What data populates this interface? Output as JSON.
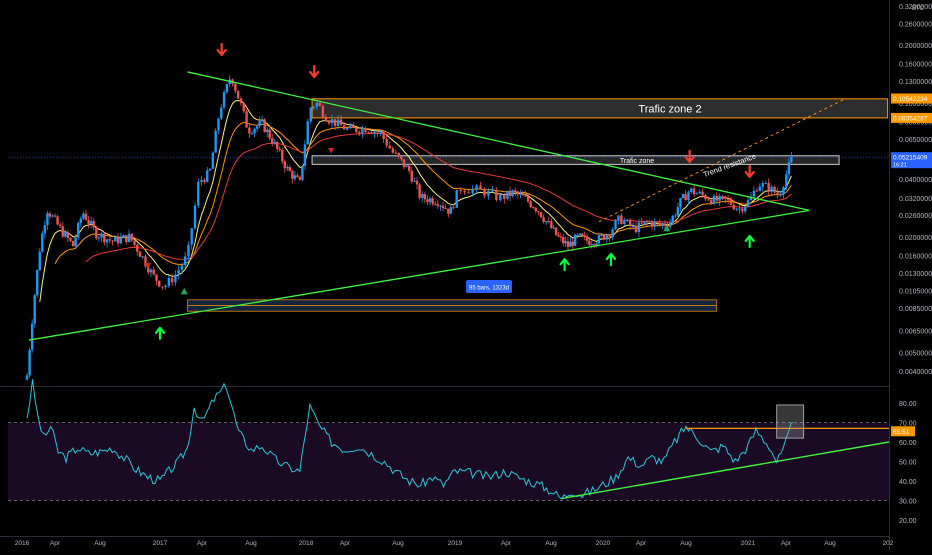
{
  "colors": {
    "background": "#000000",
    "up": "#2196f3",
    "down": "#ef5350",
    "wick_up": "#2196f3",
    "wick_down": "#ef5350",
    "ema_fast": "#fff176",
    "ema_mid": "#ff9800",
    "ema_slow": "#e53935",
    "trendline": "#3ef23e",
    "zone_border": "#ff9800",
    "zone_fill": "#3c3c3c",
    "rsi_line": "#26c6da",
    "rsi_band": "#1a0a23",
    "axis_text": "#b2b5be",
    "price_tag_blue": "#2962ff",
    "price_tag_orange": "#ff9800"
  },
  "chart_data": [
    {
      "type": "candlestick",
      "title": "",
      "quote_unit": "BTC",
      "y_scale": "log",
      "ylim": [
        0.0037,
        0.34
      ],
      "x_range": [
        "2016-01-01",
        "2021-12-31"
      ],
      "x_tick_labels": [
        "2016",
        "Apr",
        "Aug",
        "2017",
        "Apr",
        "Aug",
        "2018",
        "Apr",
        "Aug",
        "2019",
        "Apr",
        "Aug",
        "2020",
        "Apr",
        "Aug",
        "2021",
        "Apr",
        "Aug",
        "202"
      ],
      "x_tick_dates": [
        "2016-01-01",
        "2016-04-01",
        "2016-08-01",
        "2017-01-01",
        "2017-04-01",
        "2017-08-01",
        "2018-01-01",
        "2018-04-01",
        "2018-08-01",
        "2019-01-01",
        "2019-04-01",
        "2019-08-01",
        "2020-01-01",
        "2020-04-01",
        "2020-08-01",
        "2021-01-01",
        "2021-04-01",
        "2021-08-01",
        "2022-01-01"
      ],
      "y_tick_labels": [
        "0.3200000",
        "0.2600000",
        "0.2000000",
        "0.1600000",
        "0.1300000",
        "0.1000000",
        "0.0800000",
        "0.0650000",
        "0.0500000",
        "0.0400000",
        "0.0320000",
        "0.0260000",
        "0.0200000",
        "0.0160000",
        "0.0130000",
        "0.0105000",
        "0.0085000",
        "0.0065000",
        "0.0050000",
        "0.0040000"
      ],
      "y_tick_values": [
        0.32,
        0.26,
        0.2,
        0.16,
        0.13,
        0.1,
        0.08,
        0.065,
        0.05,
        0.04,
        0.032,
        0.026,
        0.02,
        0.016,
        0.013,
        0.0105,
        0.0085,
        0.0065,
        0.005,
        0.004
      ],
      "close_anchors": [
        [
          "2016-01-15",
          0.0038
        ],
        [
          "2016-02-01",
          0.0086
        ],
        [
          "2016-02-20",
          0.018
        ],
        [
          "2016-03-10",
          0.028
        ],
        [
          "2016-04-15",
          0.022
        ],
        [
          "2016-05-20",
          0.018
        ],
        [
          "2016-06-15",
          0.027
        ],
        [
          "2016-07-20",
          0.021
        ],
        [
          "2016-09-01",
          0.019
        ],
        [
          "2016-10-15",
          0.02
        ],
        [
          "2016-11-15",
          0.016
        ],
        [
          "2016-12-15",
          0.0125
        ],
        [
          "2017-01-10",
          0.011
        ],
        [
          "2017-02-01",
          0.0125
        ],
        [
          "2017-03-01",
          0.016
        ],
        [
          "2017-03-25",
          0.039
        ],
        [
          "2017-04-20",
          0.043
        ],
        [
          "2017-05-15",
          0.092
        ],
        [
          "2017-06-12",
          0.14
        ],
        [
          "2017-07-05",
          0.1
        ],
        [
          "2017-07-25",
          0.072
        ],
        [
          "2017-09-01",
          0.078
        ],
        [
          "2017-10-01",
          0.063
        ],
        [
          "2017-11-10",
          0.045
        ],
        [
          "2017-12-15",
          0.038
        ],
        [
          "2018-01-10",
          0.094
        ],
        [
          "2018-01-25",
          0.1
        ],
        [
          "2018-02-20",
          0.083
        ],
        [
          "2018-04-10",
          0.072
        ],
        [
          "2018-05-20",
          0.074
        ],
        [
          "2018-06-20",
          0.07
        ],
        [
          "2018-07-20",
          0.055
        ],
        [
          "2018-09-01",
          0.044
        ],
        [
          "2018-10-01",
          0.032
        ],
        [
          "2018-11-15",
          0.031
        ],
        [
          "2018-12-20",
          0.027
        ],
        [
          "2019-01-10",
          0.036
        ],
        [
          "2019-02-15",
          0.035
        ],
        [
          "2019-03-20",
          0.032
        ],
        [
          "2019-04-20",
          0.034
        ],
        [
          "2019-05-20",
          0.032
        ],
        [
          "2019-06-25",
          0.028
        ],
        [
          "2019-07-20",
          0.024
        ],
        [
          "2019-08-20",
          0.02
        ],
        [
          "2019-09-20",
          0.018
        ],
        [
          "2019-10-20",
          0.02
        ],
        [
          "2019-11-20",
          0.019
        ],
        [
          "2019-12-20",
          0.0195
        ],
        [
          "2020-01-15",
          0.021
        ],
        [
          "2020-02-10",
          0.025
        ],
        [
          "2020-03-15",
          0.022
        ],
        [
          "2020-04-20",
          0.024
        ],
        [
          "2020-05-20",
          0.023
        ],
        [
          "2020-06-20",
          0.024
        ],
        [
          "2020-07-15",
          0.03
        ],
        [
          "2020-08-10",
          0.035
        ],
        [
          "2020-09-10",
          0.033
        ],
        [
          "2020-10-10",
          0.031
        ],
        [
          "2020-11-10",
          0.031
        ],
        [
          "2020-12-10",
          0.028
        ],
        [
          "2021-01-05",
          0.031
        ],
        [
          "2021-01-25",
          0.038
        ],
        [
          "2021-02-20",
          0.036
        ],
        [
          "2021-03-15",
          0.033
        ],
        [
          "2021-04-01",
          0.042
        ],
        [
          "2021-04-20",
          0.054
        ]
      ],
      "moving_averages": [
        {
          "role": "ema_fast",
          "periods": 9
        },
        {
          "role": "ema_mid",
          "periods": 21
        },
        {
          "role": "ema_slow",
          "periods": 45
        }
      ],
      "trendlines": [
        {
          "name": "descending",
          "from": [
            "2017-03-01",
            0.145
          ],
          "to": [
            "2021-06-05",
            0.0275
          ]
        },
        {
          "name": "ascending",
          "from": [
            "2016-01-20",
            0.0058
          ],
          "to": [
            "2021-06-05",
            0.0275
          ]
        },
        {
          "name": "trend-resistance",
          "style": "dashed",
          "from": [
            "2019-12-20",
            0.024
          ],
          "to": [
            "2021-09-10",
            0.105
          ]
        }
      ],
      "zones": [
        {
          "label": "Trafic zone 2",
          "x_from": "2018-01-15",
          "x_to": "2021-12-31",
          "y_from": 0.0835,
          "y_to": 0.105,
          "border": "#ff9800"
        },
        {
          "label": "Trafic zone",
          "x_from": "2018-01-15",
          "x_to": "2021-08-25",
          "y_from": 0.0478,
          "y_to": 0.053,
          "border": "#cccccc"
        }
      ],
      "date_range_box": {
        "label": "95 bars, 1323d",
        "x_from": "2017-03-01",
        "x_to": "2020-10-15",
        "y_from": 0.0082,
        "y_to": 0.0094
      },
      "annotations": [
        {
          "text": "Trend resistance",
          "at": [
            "2020-09-15",
            0.041
          ]
        }
      ],
      "down_arrows": [
        "2017-05-20",
        "2018-01-20",
        "2020-08-10",
        "2021-01-05"
      ],
      "up_arrows": [
        [
          "2017-01-01",
          0.0068
        ],
        [
          "2019-09-10",
          0.0155
        ],
        [
          "2020-01-20",
          0.0165
        ],
        [
          "2021-01-05",
          0.0205
        ]
      ],
      "green_triangles": [
        [
          "2017-02-22",
          0.0104
        ],
        [
          "2020-06-10",
          0.0222
        ]
      ],
      "red_triangles": [
        [
          "2016-12-01",
          0.0142
        ],
        [
          "2018-02-28",
          0.0565
        ]
      ],
      "price_tags": [
        {
          "label": "0.10542234",
          "value": 0.1054,
          "color": "#ff9800"
        },
        {
          "label": "0.08354287",
          "value": 0.0835,
          "color": "#ff9800"
        },
        {
          "label": "0.05215409",
          "sublabel": "16:21",
          "value": 0.0521,
          "color": "#2962ff"
        }
      ]
    },
    {
      "type": "line",
      "name": "RSI",
      "ylim": [
        14,
        95
      ],
      "y_tick_labels": [
        "80.00",
        "70.00",
        "60.00",
        "50.00",
        "40.00",
        "30.00",
        "20.00"
      ],
      "y_tick_values": [
        80,
        70,
        60,
        50,
        40,
        30,
        20
      ],
      "upper_band": 70,
      "lower_band": 30,
      "current_label": "65.51",
      "current_value": 65.5,
      "rsi_anchors": [
        [
          "2016-01-15",
          73
        ],
        [
          "2016-01-30",
          90
        ],
        [
          "2016-02-15",
          72
        ],
        [
          "2016-03-01",
          62
        ],
        [
          "2016-03-20",
          68
        ],
        [
          "2016-04-10",
          55
        ],
        [
          "2016-05-01",
          52
        ],
        [
          "2016-06-01",
          57
        ],
        [
          "2016-07-01",
          54
        ],
        [
          "2016-08-01",
          55
        ],
        [
          "2016-09-01",
          57
        ],
        [
          "2016-10-01",
          52
        ],
        [
          "2016-11-01",
          46
        ],
        [
          "2016-12-01",
          42
        ],
        [
          "2017-01-01",
          40
        ],
        [
          "2017-01-20",
          45
        ],
        [
          "2017-02-10",
          50
        ],
        [
          "2017-03-01",
          57
        ],
        [
          "2017-03-15",
          78
        ],
        [
          "2017-04-01",
          70
        ],
        [
          "2017-05-01",
          82
        ],
        [
          "2017-06-01",
          89
        ],
        [
          "2017-07-01",
          65
        ],
        [
          "2017-08-01",
          56
        ],
        [
          "2017-09-01",
          58
        ],
        [
          "2017-10-01",
          52
        ],
        [
          "2017-11-01",
          48
        ],
        [
          "2017-12-15",
          45
        ],
        [
          "2018-01-10",
          78
        ],
        [
          "2018-02-01",
          68
        ],
        [
          "2018-03-01",
          60
        ],
        [
          "2018-04-01",
          56
        ],
        [
          "2018-05-01",
          58
        ],
        [
          "2018-06-01",
          54
        ],
        [
          "2018-07-01",
          50
        ],
        [
          "2018-08-01",
          44
        ],
        [
          "2018-09-01",
          40
        ],
        [
          "2018-10-01",
          38
        ],
        [
          "2018-11-01",
          42
        ],
        [
          "2018-12-01",
          38
        ],
        [
          "2019-01-01",
          45
        ],
        [
          "2019-02-01",
          44
        ],
        [
          "2019-03-01",
          42
        ],
        [
          "2019-04-01",
          45
        ],
        [
          "2019-05-01",
          42
        ],
        [
          "2019-06-01",
          40
        ],
        [
          "2019-07-01",
          38
        ],
        [
          "2019-08-01",
          35
        ],
        [
          "2019-09-01",
          31
        ],
        [
          "2019-10-01",
          35
        ],
        [
          "2019-11-01",
          33
        ],
        [
          "2019-12-01",
          35
        ],
        [
          "2020-01-01",
          38
        ],
        [
          "2020-02-01",
          42
        ],
        [
          "2020-03-01",
          52
        ],
        [
          "2020-04-01",
          48
        ],
        [
          "2020-05-01",
          52
        ],
        [
          "2020-06-01",
          50
        ],
        [
          "2020-07-01",
          60
        ],
        [
          "2020-08-01",
          68
        ],
        [
          "2020-09-01",
          62
        ],
        [
          "2020-10-01",
          55
        ],
        [
          "2020-11-01",
          58
        ],
        [
          "2020-12-01",
          50
        ],
        [
          "2021-01-01",
          58
        ],
        [
          "2021-01-20",
          66
        ],
        [
          "2021-02-20",
          58
        ],
        [
          "2021-03-10",
          50
        ],
        [
          "2021-03-25",
          55
        ],
        [
          "2021-04-10",
          65
        ],
        [
          "2021-04-20",
          70
        ]
      ],
      "trendlines": [
        {
          "name": "rsi-support",
          "from": [
            "2019-09-01",
            31
          ],
          "to": [
            "2021-12-31",
            60
          ]
        },
        {
          "name": "rsi-resistance",
          "from": [
            "2020-08-01",
            67
          ],
          "to": [
            "2021-12-31",
            67
          ]
        }
      ],
      "highlight_box": {
        "x_from": "2021-03-10",
        "x_to": "2021-05-20",
        "y_from": 62,
        "y_to": 79
      }
    }
  ]
}
